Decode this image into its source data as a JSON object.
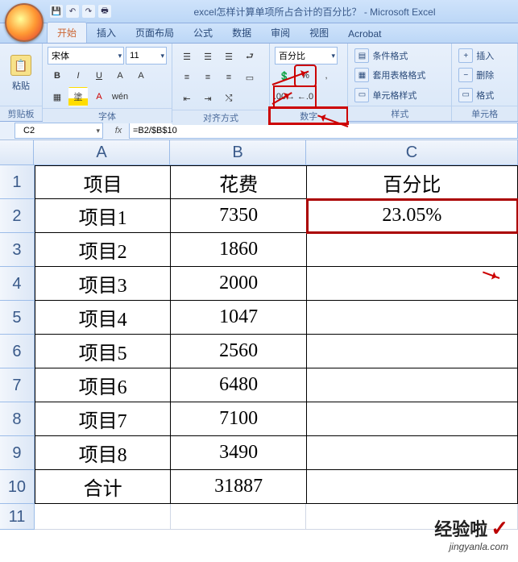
{
  "window": {
    "title": "excel怎样计算单项所占合计的百分比？ - Microsoft Excel"
  },
  "qat": {
    "save_icon": "💾",
    "undo_icon": "↶",
    "redo_icon": "↷",
    "print_icon": "🖶"
  },
  "tabs": {
    "home": "开始",
    "insert": "插入",
    "page_layout": "页面布局",
    "formulas": "公式",
    "data": "数据",
    "review": "审阅",
    "view": "视图",
    "acrobat": "Acrobat"
  },
  "ribbon": {
    "clipboard": {
      "paste_label": "粘贴",
      "group_label": "剪贴板"
    },
    "font": {
      "font_name": "宋体",
      "font_size": "11",
      "b": "B",
      "i": "I",
      "u": "U",
      "group_label": "字体"
    },
    "alignment": {
      "group_label": "对齐方式"
    },
    "number": {
      "format": "百分比",
      "percent_symbol": "%",
      "comma_symbol": ",",
      "inc_dec": ".00",
      "dec_dec": ".0",
      "group_label": "数字"
    },
    "styles": {
      "conditional": "条件格式",
      "format_table": "套用表格格式",
      "cell_styles": "单元格样式",
      "group_label": "样式"
    },
    "cells": {
      "insert": "插入",
      "delete": "删除",
      "format": "格式",
      "group_label": "单元格"
    }
  },
  "namebox": {
    "value": "C2"
  },
  "formula_bar": {
    "fx": "fx",
    "formula": "=B2/$B$10"
  },
  "columns": {
    "a": "A",
    "b": "B",
    "c": "C"
  },
  "rows": [
    "1",
    "2",
    "3",
    "4",
    "5",
    "6",
    "7",
    "8",
    "9",
    "10",
    "11"
  ],
  "data": {
    "header": {
      "a": "项目",
      "b": "花费",
      "c": "百分比"
    },
    "r2": {
      "a": "项目1",
      "b": "7350",
      "c": "23.05%"
    },
    "r3": {
      "a": "项目2",
      "b": "1860",
      "c": ""
    },
    "r4": {
      "a": "项目3",
      "b": "2000",
      "c": ""
    },
    "r5": {
      "a": "项目4",
      "b": "1047",
      "c": ""
    },
    "r6": {
      "a": "项目5",
      "b": "2560",
      "c": ""
    },
    "r7": {
      "a": "项目6",
      "b": "6480",
      "c": ""
    },
    "r8": {
      "a": "项目7",
      "b": "7100",
      "c": ""
    },
    "r9": {
      "a": "项目8",
      "b": "3490",
      "c": ""
    },
    "r10": {
      "a": "合计",
      "b": "31887",
      "c": ""
    }
  },
  "watermark": {
    "line1": "经验啦",
    "check": "✓",
    "line2": "jingyanla.com"
  }
}
